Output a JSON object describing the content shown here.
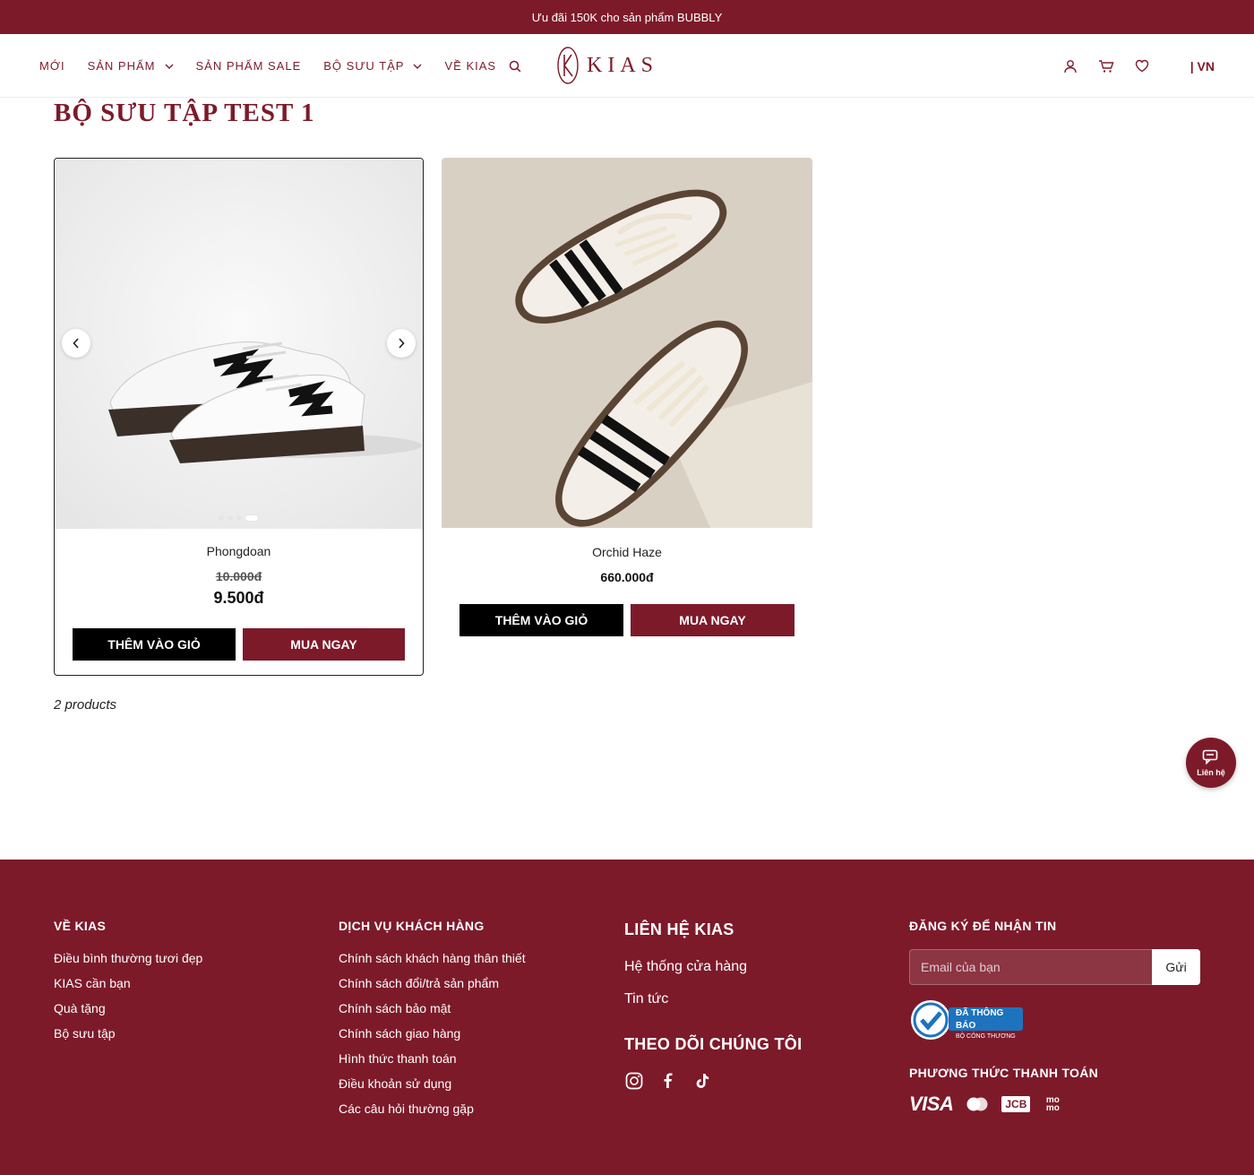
{
  "announcement": "Ưu đãi 150K cho sản phẩm BUBBLY",
  "nav": {
    "items": [
      "MỚI",
      "SẢN PHẨM",
      "SẢN PHẨM SALE",
      "BỘ SƯU TẬP",
      "VỀ KIAS"
    ]
  },
  "logo": {
    "text": "KIAS"
  },
  "header": {
    "lang": "| VN"
  },
  "page": {
    "title": "BỘ SƯU TẬP TEST 1",
    "count": "2 products"
  },
  "products": [
    {
      "name": "Phongdoan",
      "old_price": "10.000đ",
      "price": "9.500đ",
      "add_label": "THÊM VÀO GIỎ",
      "buy_label": "MUA NGAY"
    },
    {
      "name": "Orchid Haze",
      "price": "660.000đ",
      "add_label": "THÊM VÀO GIỎ",
      "buy_label": "MUA NGAY"
    }
  ],
  "chat": {
    "label": "Liên hệ"
  },
  "footer": {
    "about": {
      "heading": "VỀ KIAS",
      "links": [
        "Điều bình thường tươi đẹp",
        "KIAS cần bạn",
        "Quà tặng",
        "Bộ sưu tập"
      ]
    },
    "service": {
      "heading": "DỊCH VỤ KHÁCH HÀNG",
      "links": [
        "Chính sách khách hàng thân thiết",
        "Chính sách đổi/trả sản phẩm",
        "Chính sách bảo mật",
        "Chính sách giao hàng",
        "Hình thức thanh toán",
        "Điều khoản sử dụng",
        "Các câu hỏi thường gặp"
      ]
    },
    "contact": {
      "heading": "LIÊN HỆ KIAS",
      "links": [
        "Hệ thống cửa hàng",
        "Tin tức"
      ],
      "follow_heading": "THEO DÕI CHÚNG TÔI"
    },
    "newsletter": {
      "heading": "ĐĂNG KÝ ĐỂ NHẬN TIN",
      "placeholder": "Email của bạn",
      "button": "Gửi",
      "badge_main": "ĐÃ THÔNG BÁO",
      "badge_sub": "BỘ CÔNG THƯƠNG",
      "payment_heading": "PHƯƠNG THỨC THANH TOÁN",
      "payment_methods": [
        "VISA",
        "JCB",
        "mo mo"
      ]
    }
  },
  "colors": {
    "brand": "#7d1a2a",
    "black": "#000000",
    "white": "#ffffff"
  }
}
